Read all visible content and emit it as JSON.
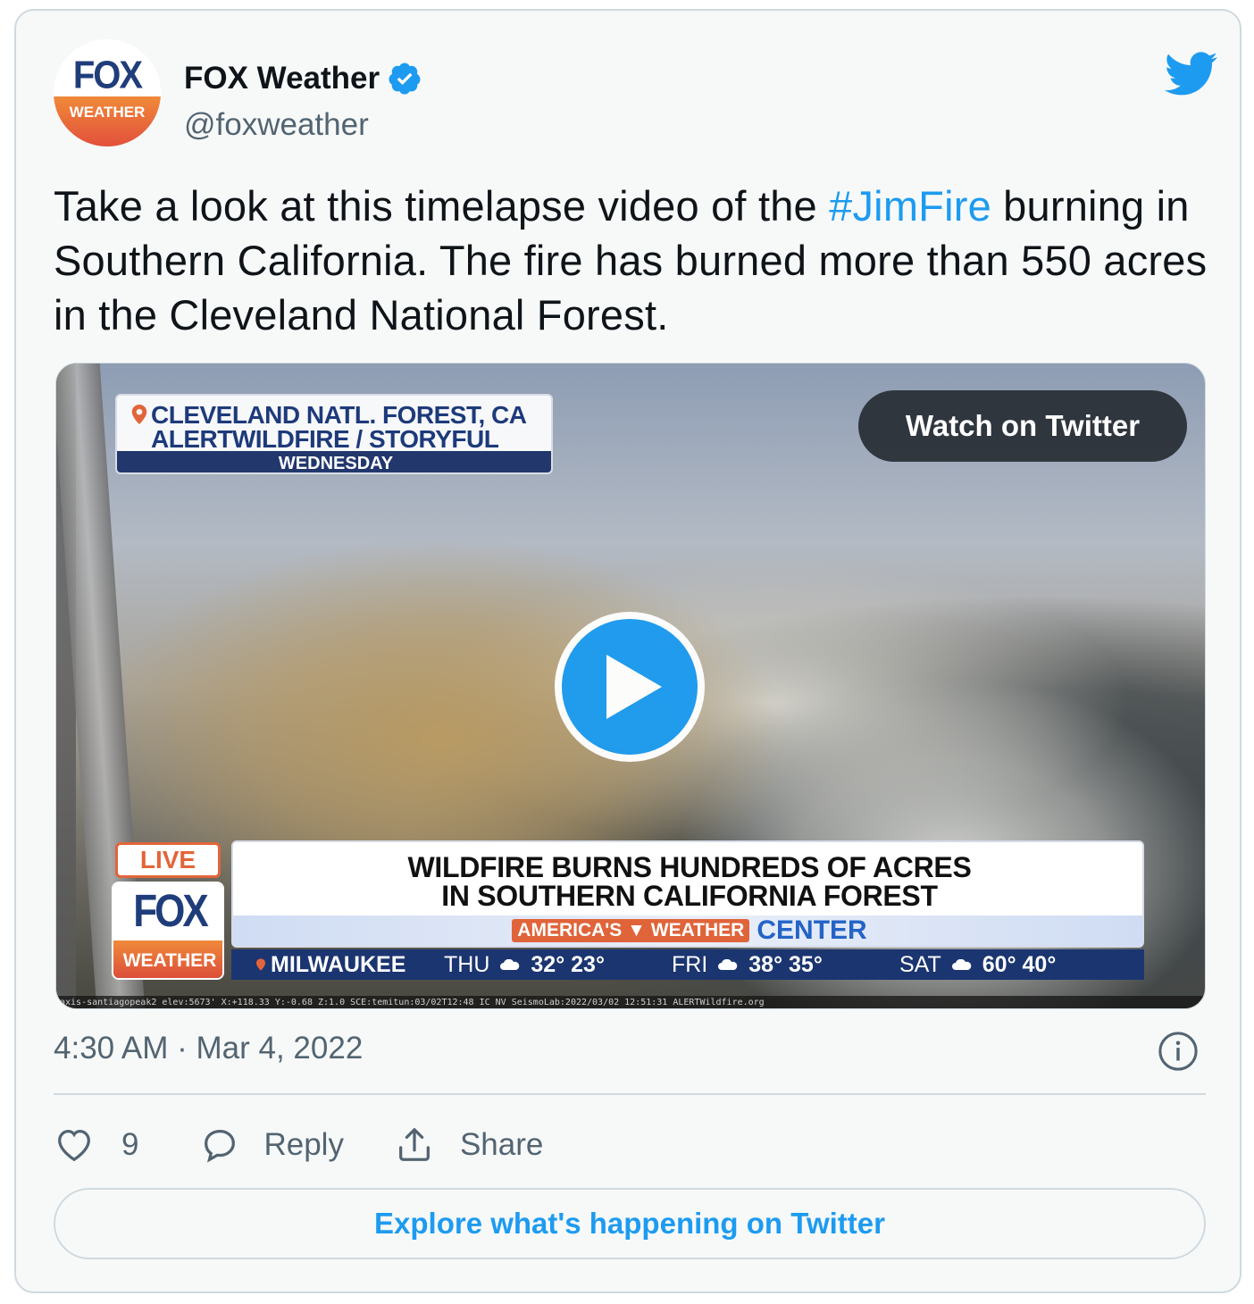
{
  "author": {
    "name": "FOX Weather",
    "handle": "@foxweather",
    "avatar_top": "FOX",
    "avatar_bottom": "WEATHER",
    "verified": true
  },
  "tweet": {
    "text_before": "Take a look at this timelapse video of the ",
    "hashtag": "#JimFire",
    "text_after": " burning in Southern California. The fire has burned more than 550 acres in the Cleveland National Forest."
  },
  "media": {
    "location_line1": "CLEVELAND NATL. FOREST, CA",
    "location_line2": "ALERTWILDFIRE / STORYFUL",
    "location_day": "WEDNESDAY",
    "watch_label": "Watch on Twitter",
    "live_label": "LIVE",
    "logo_top": "FOX",
    "logo_bottom": "WEATHER",
    "headline_line1": "WILDFIRE BURNS HUNDREDS OF ACRES",
    "headline_line2": "IN SOUTHERN CALIFORNIA FOREST",
    "brand_tag": "AMERICA'S ▼ WEATHER",
    "brand_center": "CENTER",
    "ticker": {
      "city": "MILWAUKEE",
      "days": [
        {
          "day": "THU",
          "temps": "32° 23°"
        },
        {
          "day": "FRI",
          "temps": "38° 35°"
        },
        {
          "day": "SAT",
          "temps": "60° 40°"
        }
      ]
    },
    "camera_strip": "axis-santiagopeak2 elev:5673' X:+118.33 Y:-0.68 Z:1.0 SCE:temitun:03/02T12:48 IC NV SeismoLab:2022/03/02 12:51:31 ALERTWildfire.org"
  },
  "footer": {
    "timestamp": "4:30 AM · Mar 4, 2022",
    "like_count": "9",
    "reply_label": "Reply",
    "share_label": "Share",
    "explore_label": "Explore what's happening on Twitter"
  },
  "colors": {
    "accent": "#1d9bf0",
    "text": "#0f1419",
    "secondary": "#536471",
    "border": "#cfd9de"
  }
}
